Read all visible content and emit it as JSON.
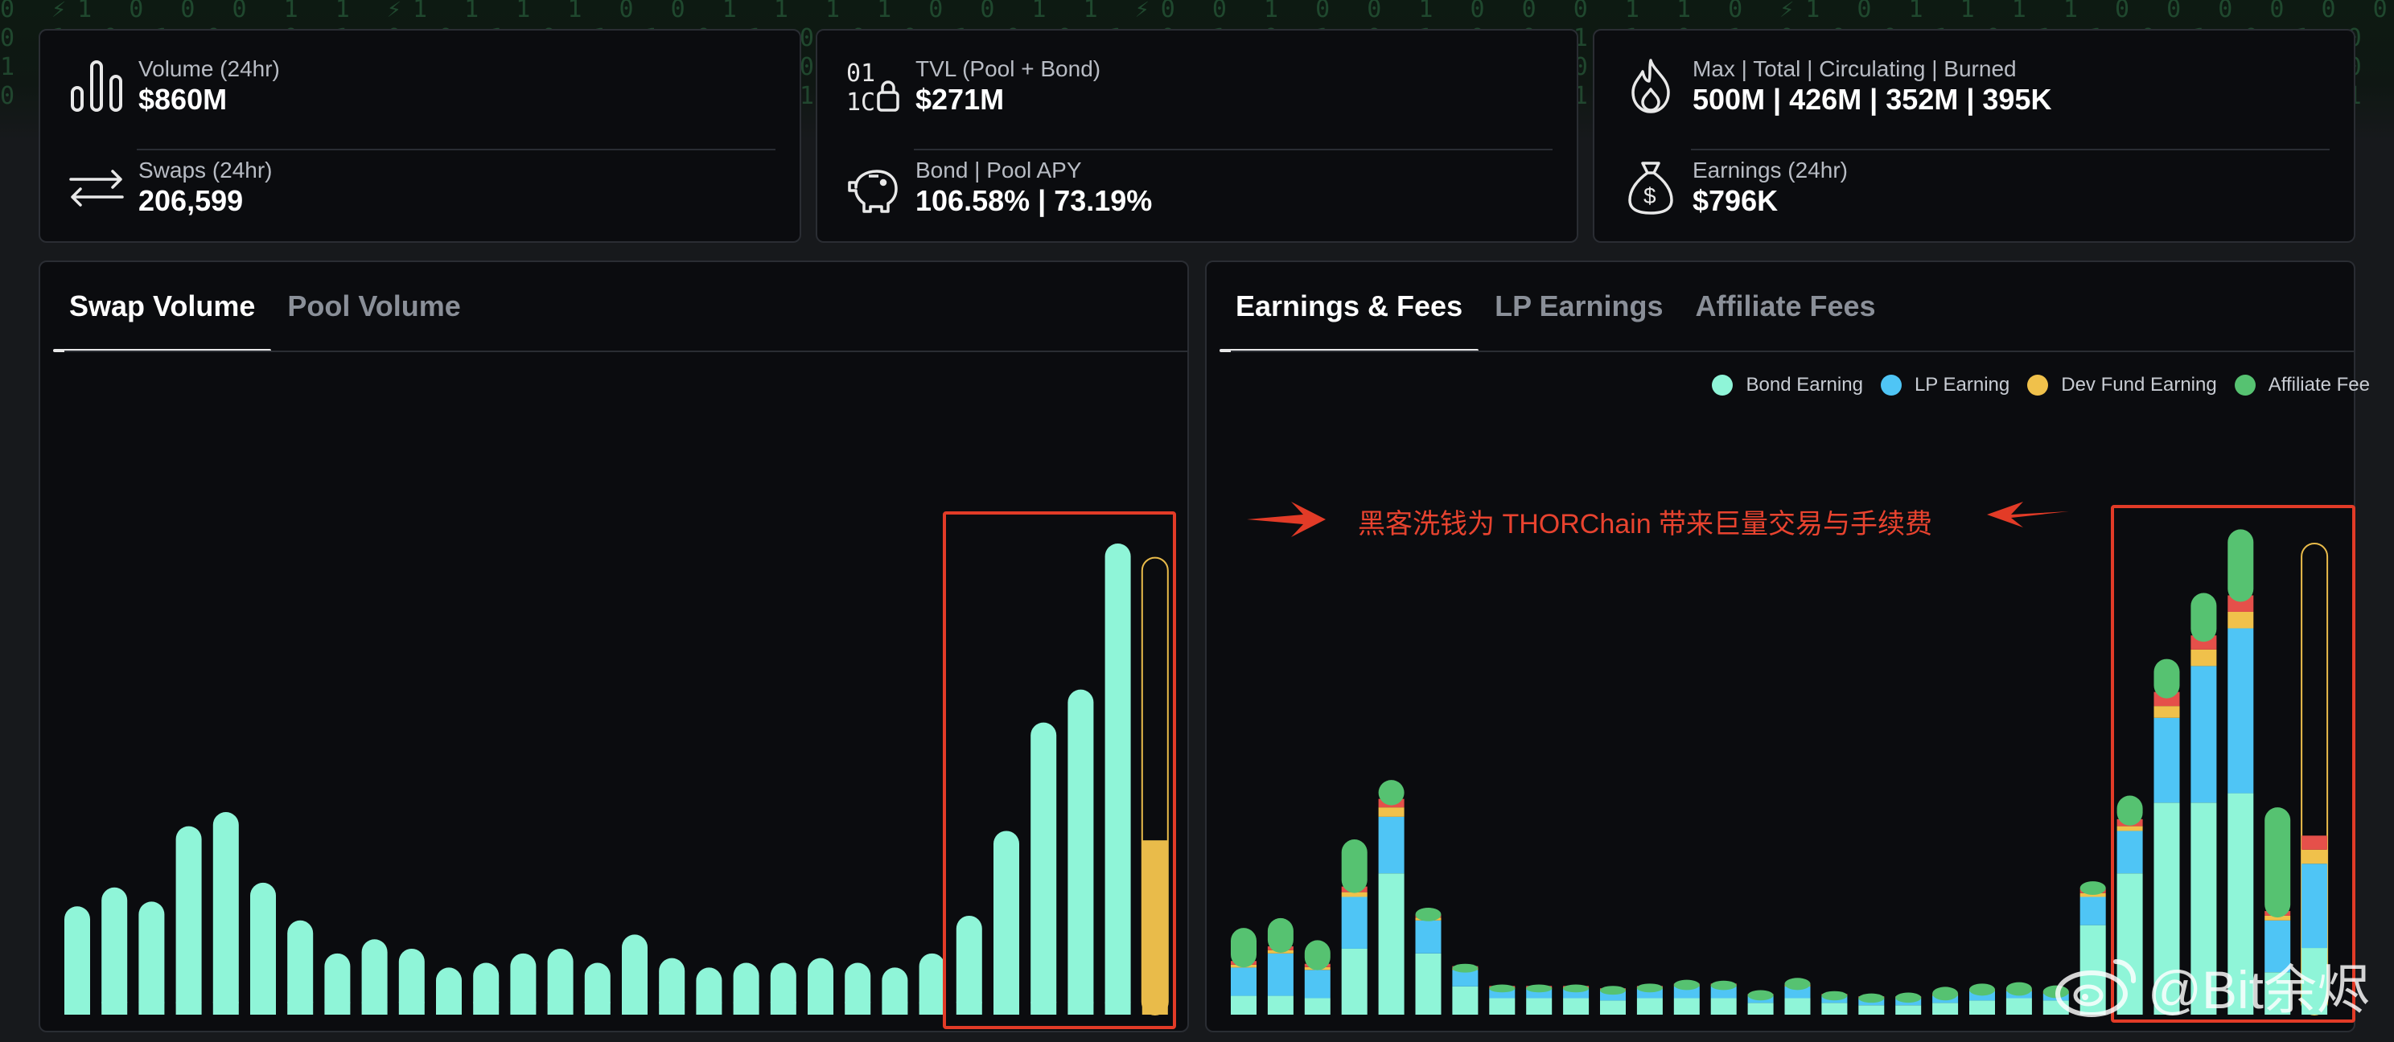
{
  "stats": [
    {
      "label": "Volume (24hr)",
      "value": "$860M",
      "icon": "bar-chart-icon"
    },
    {
      "label": "Swaps (24hr)",
      "value": "206,599",
      "icon": "swap-arrows-icon"
    },
    {
      "label": "TVL (Pool + Bond)",
      "value": "$271M",
      "icon": "binary-lock-icon"
    },
    {
      "label": "Bond | Pool APY",
      "value": "106.58% | 73.19%",
      "icon": "piggy-bank-icon"
    },
    {
      "label": "Max | Total | Circulating | Burned",
      "value": "500M | 426M | 352M | 395K",
      "icon": "flame-icon"
    },
    {
      "label": "Earnings (24hr)",
      "value": "$796K",
      "icon": "money-bag-icon"
    }
  ],
  "volume_panel": {
    "tabs": [
      "Swap Volume",
      "Pool Volume"
    ],
    "active_tab": 0
  },
  "earnings_panel": {
    "tabs": [
      "Earnings & Fees",
      "LP Earnings",
      "Affiliate Fees"
    ],
    "active_tab": 0
  },
  "annotation": {
    "text": "黑客洗钱为 THORChain 带来巨量交易与手续费"
  },
  "watermark": {
    "text": "@Bit余烬",
    "icon": "weibo-icon"
  },
  "colors": {
    "bond": "#8ff5d8",
    "lp": "#4fc5f5",
    "dev": "#f0c14b",
    "affiliate": "#56c271",
    "red_band": "#e5504a",
    "highlight": "#e23b27",
    "current_bar": "#e9bb4a"
  },
  "chart_data": [
    {
      "type": "bar",
      "title": "Swap Volume",
      "categories": [],
      "values": [
        23,
        27,
        24,
        40,
        43,
        28,
        20,
        13,
        16,
        14,
        10,
        11,
        13,
        14,
        11,
        17,
        12,
        10,
        11,
        11,
        12,
        11,
        10,
        13,
        21,
        39,
        62,
        69,
        100
      ],
      "current_bar": {
        "value": 37,
        "max": 97
      },
      "ylim": [
        0,
        100
      ],
      "grid": false
    },
    {
      "type": "bar",
      "title": "Earnings & Fees",
      "stacked": true,
      "legend": {
        "position": "top-right"
      },
      "categories": [],
      "series": [
        {
          "name": "Bond Earning",
          "values": [
            4,
            4,
            3.5,
            14,
            30,
            13,
            6,
            3.5,
            3.5,
            3.5,
            3,
            3.5,
            3.5,
            3.5,
            2.5,
            3.5,
            2.5,
            2,
            2,
            2.5,
            3,
            3.5,
            3,
            19,
            30,
            45,
            45,
            47,
            9
          ]
        },
        {
          "name": "LP Earning",
          "values": [
            6,
            9,
            6,
            11,
            12,
            7,
            3.5,
            2,
            2,
            2,
            2,
            2,
            2.5,
            2.5,
            1.5,
            2.5,
            1.5,
            1.5,
            1.5,
            1.5,
            2,
            1.5,
            1.5,
            6,
            9,
            18,
            29,
            35,
            11
          ]
        },
        {
          "name": "Dev Fund Earning",
          "values": [
            0.6,
            0.7,
            0.6,
            1,
            2,
            0.6,
            0.4,
            0.3,
            0.3,
            0.3,
            0.3,
            0.3,
            0.3,
            0.3,
            0.2,
            0.3,
            0.2,
            0.2,
            0.2,
            0.2,
            0.2,
            0.2,
            0.2,
            0.8,
            1,
            2.5,
            3.5,
            3.5,
            1
          ]
        },
        {
          "name": "Affiliate Fee",
          "values": [
            7,
            6,
            5,
            10,
            4,
            1.5,
            0.5,
            0.3,
            0.3,
            0.3,
            0.5,
            0.5,
            0.8,
            0.6,
            0.8,
            1.2,
            0.6,
            0.6,
            0.8,
            1.5,
            1.2,
            1.5,
            1.3,
            1.5,
            5,
            7,
            9,
            14,
            22
          ]
        }
      ],
      "red_band": [
        0.8,
        0.8,
        0.7,
        1.2,
        1.8,
        0.6,
        0.4,
        0.3,
        0.3,
        0.3,
        0.3,
        0.3,
        0.3,
        0.3,
        0.2,
        0.3,
        0.2,
        0.2,
        0.2,
        0.2,
        0.2,
        0.2,
        0.2,
        1,
        1.5,
        3,
        3,
        3.5,
        1
      ],
      "current_bar": {
        "value": 38,
        "max": 100
      },
      "ylim": [
        0,
        100
      ],
      "grid": false
    }
  ]
}
